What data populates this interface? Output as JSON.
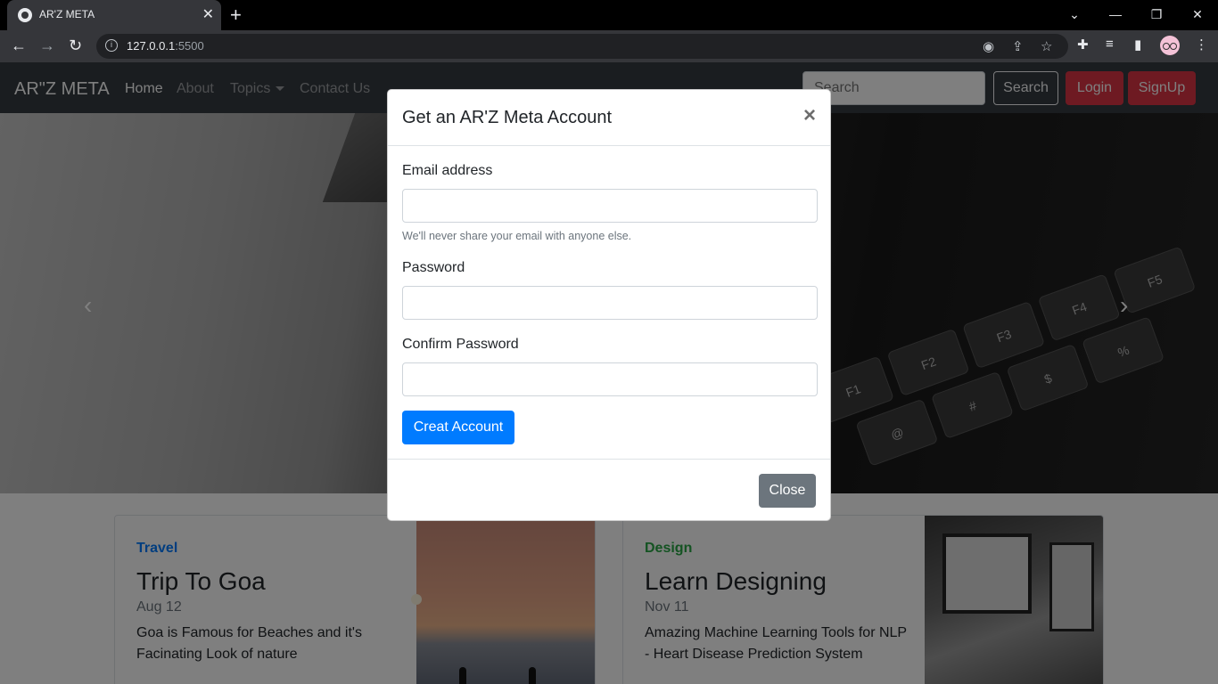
{
  "browser": {
    "tab_title": "AR'Z META",
    "url_host": "127.0.0.1",
    "url_port": ":5500"
  },
  "navbar": {
    "brand": "AR\"Z META",
    "links": [
      "Home",
      "About",
      "Topics",
      "Contact Us"
    ],
    "search_placeholder": "Search",
    "search_button": "Search",
    "login_button": "Login",
    "signup_button": "SignUp"
  },
  "cards": [
    {
      "category": "Travel",
      "category_color": "#007bff",
      "title": "Trip To Goa",
      "date": "Aug 12",
      "text": "Goa is Famous for Beaches and it's Facinating Look of nature"
    },
    {
      "category": "Design",
      "category_color": "#28a745",
      "title": "Learn Designing",
      "date": "Nov 11",
      "text": "Amazing Machine Learning Tools for NLP - Heart Disease Prediction System"
    }
  ],
  "modal": {
    "title": "Get an AR'Z Meta Account",
    "close_icon": "×",
    "email_label": "Email address",
    "email_help": "We'll never share your email with anyone else.",
    "password_label": "Password",
    "confirm_label": "Confirm Password",
    "submit_button": "Creat Account",
    "close_button": "Close"
  },
  "carousel": {
    "prev_icon": "‹",
    "next_icon": "›",
    "keys": [
      "F1",
      "F2",
      "F3",
      "F4",
      "F5",
      "@",
      "#",
      "$",
      "%"
    ]
  }
}
